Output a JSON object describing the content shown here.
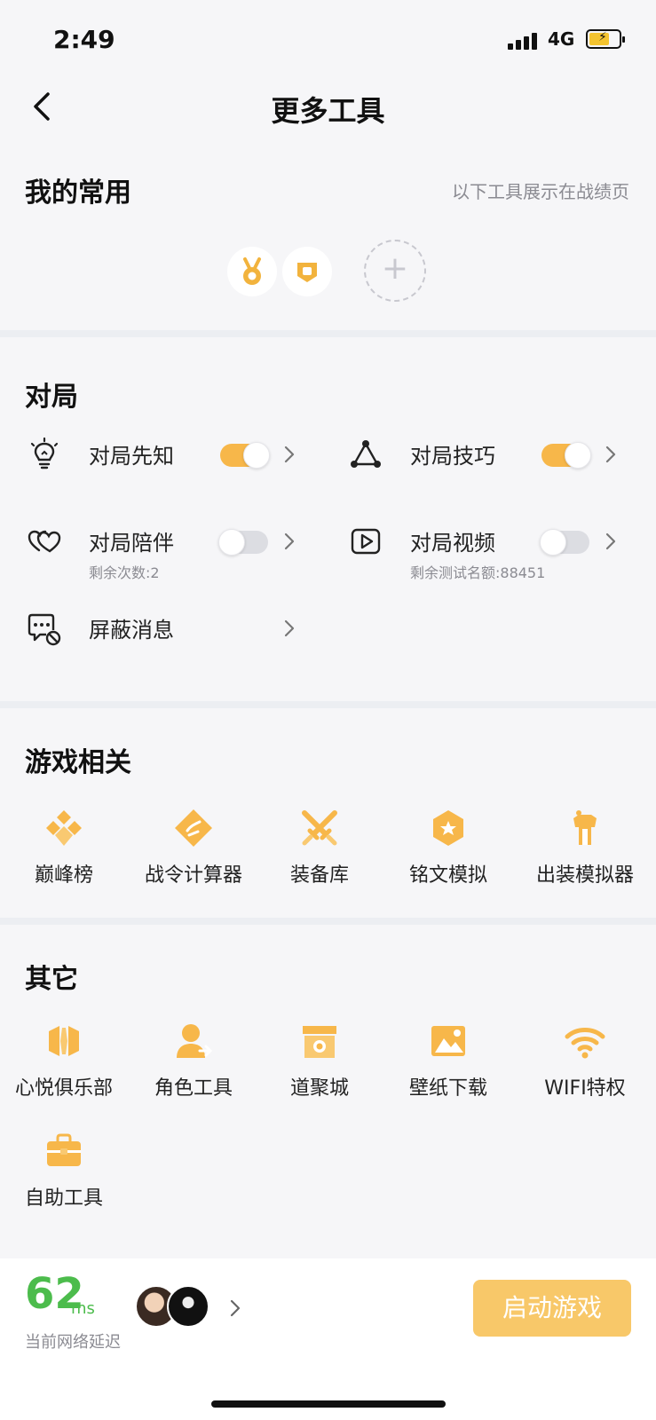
{
  "status_bar": {
    "time": "2:49",
    "network": "4G"
  },
  "nav": {
    "title": "更多工具"
  },
  "favorites": {
    "title": "我的常用",
    "hint": "以下工具展示在战绩页",
    "add_label": "+"
  },
  "match": {
    "title": "对局",
    "items": [
      {
        "label": "对局先知",
        "icon": "lightbulb-icon",
        "toggle": true
      },
      {
        "label": "对局技巧",
        "icon": "triangle-nodes-icon",
        "toggle": true
      },
      {
        "label": "对局陪伴",
        "icon": "double-heart-icon",
        "toggle": false,
        "sub": "剩余次数:2"
      },
      {
        "label": "对局视频",
        "icon": "play-video-icon",
        "toggle": false,
        "sub": "剩余测试名额:88451"
      },
      {
        "label": "屏蔽消息",
        "icon": "block-message-icon"
      }
    ]
  },
  "game": {
    "title": "游戏相关",
    "items": [
      {
        "label": "巅峰榜",
        "icon": "peak-rank-icon"
      },
      {
        "label": "战令计算器",
        "icon": "calculator-icon"
      },
      {
        "label": "装备库",
        "icon": "crossed-swords-icon"
      },
      {
        "label": "铭文模拟",
        "icon": "inscription-icon"
      },
      {
        "label": "出装模拟器",
        "icon": "armor-icon"
      }
    ]
  },
  "other": {
    "title": "其它",
    "items": [
      {
        "label": "心悦俱乐部",
        "icon": "club-icon"
      },
      {
        "label": "角色工具",
        "icon": "role-icon"
      },
      {
        "label": "道聚城",
        "icon": "store-icon"
      },
      {
        "label": "壁纸下载",
        "icon": "wallpaper-icon"
      },
      {
        "label": "WIFI特权",
        "icon": "wifi-icon"
      },
      {
        "label": "自助工具",
        "icon": "toolbox-icon"
      }
    ]
  },
  "bottom": {
    "latency_value": "62",
    "latency_unit": "ms",
    "latency_label": "当前网络延迟",
    "launch_label": "启动游戏"
  },
  "colors": {
    "accent": "#f7b74a",
    "latency": "#4cbc4c",
    "background": "#f6f6f8"
  }
}
